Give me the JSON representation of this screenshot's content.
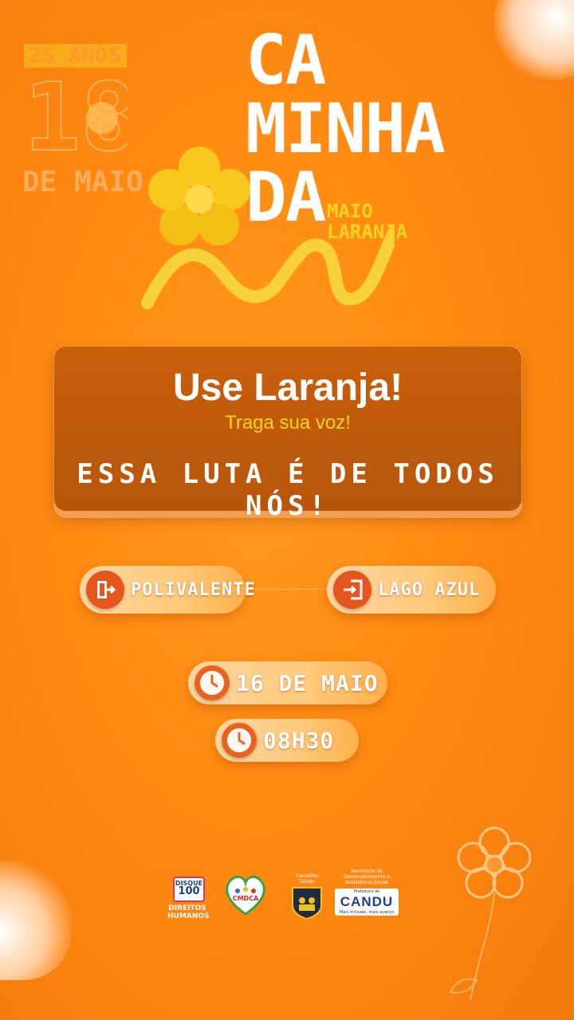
{
  "watermark": {
    "anos": "25 ANOS",
    "day": "18",
    "de_maio": "DE MAIO"
  },
  "title": {
    "lines": [
      "CA",
      "MINHA",
      "DA"
    ],
    "subtitle_lines": [
      "MAIO",
      "LARANJA"
    ]
  },
  "card": {
    "headline": "Use Laranja!",
    "tagline": "Traga sua voz!",
    "slogan": "ESSA LUTA É DE TODOS NÓS!"
  },
  "route": {
    "start": "POLIVALENTE",
    "end": "LAGO AZUL"
  },
  "event": {
    "date": "16 DE MAIO",
    "time": "08H30"
  },
  "logos": {
    "disque_top": "DISQUE",
    "disque_num": "100",
    "direitos_humanos": "DIREITOS HUMANOS",
    "cmdca": "CMDCA",
    "conselho_tutelar": "Conselho Tutelar",
    "secretaria": "Secretaria de Desenvolvimento e Assistência Social",
    "cidade": "CANDU",
    "prefeitura": "Prefeitura de",
    "cidade_slogan": "Mais inclusão, mais avanço"
  },
  "colors": {
    "background": "#ff8a12",
    "card": "#b8560a",
    "accent_yellow": "#ffd41f",
    "icon_red": "#e5561c"
  }
}
